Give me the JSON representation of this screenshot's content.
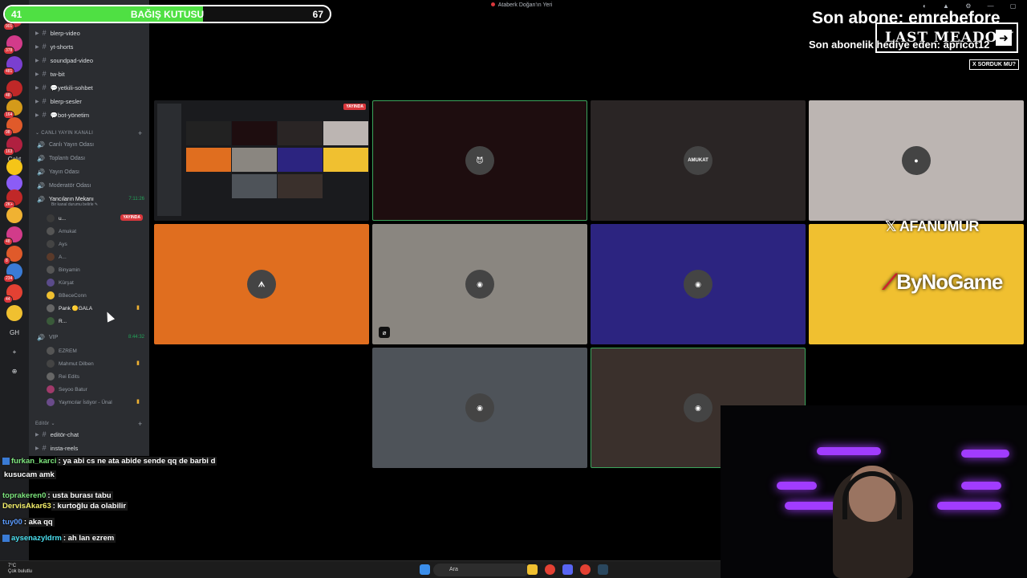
{
  "donation": {
    "title": "BAĞIŞ KUTUSU",
    "current": "41",
    "target": "67",
    "progress": 0.61
  },
  "window": {
    "title": "Ataberk Doğan'ın Yeri",
    "controls": "◐ ▲ ⚙ — ▢ ✕"
  },
  "overlay": {
    "last_sub": "Son abone: emrebefore",
    "last_gift": "Son abonelik hediye eden: apricot12",
    "last_meadow": "LAST MEADOW",
    "sorduk": "X SORDUK MU?",
    "afanumur": "AFANUMUR",
    "bynogame": "ByNoGame"
  },
  "rail": {
    "items": [
      {
        "badge": "901"
      },
      {
        "badge": "378"
      },
      {
        "badge": "481"
      },
      {
        "badge": "48"
      },
      {
        "badge": "164"
      },
      {
        "badge": "98"
      },
      {
        "badge": "163"
      },
      {
        "label": "Çalıt"
      },
      {
        "badge": ""
      },
      {
        "badge": ""
      },
      {
        "badge": "2K+"
      },
      {
        "badge": ""
      },
      {
        "badge": "48"
      },
      {
        "badge": "8"
      },
      {
        "badge": "234"
      },
      {
        "badge": "44"
      },
      {
        "badge": ""
      },
      {
        "label": "GH"
      },
      {
        "label": "+"
      },
      {
        "label": "⊕"
      }
    ]
  },
  "channels": {
    "text_top": [
      {
        "name": "blerp-video"
      },
      {
        "name": "yt-shorts"
      },
      {
        "name": "soundpad-video"
      },
      {
        "name": "tw-bit"
      },
      {
        "name": "💬yetkili-sohbet"
      },
      {
        "name": "blerp-sesler"
      },
      {
        "name": "💬bot-yönetim"
      }
    ],
    "voice_category": "CANLI YAYIN KANALI",
    "voice": [
      {
        "name": "Canlı Yayın Odası"
      },
      {
        "name": "Toplantı Odası"
      },
      {
        "name": "Yayın Odası"
      },
      {
        "name": "Moderatör Odası"
      }
    ],
    "active_voice": {
      "name": "Yancıların Mekanı",
      "time": "7:11:26",
      "sub": "Bir kanal durumu belirle ✎"
    },
    "users": [
      {
        "name": "u...",
        "live": "YAYINDA"
      },
      {
        "name": "Amukat"
      },
      {
        "name": "Ays"
      },
      {
        "name": "A..."
      },
      {
        "name": "Binyamin"
      },
      {
        "name": "Kürşat"
      },
      {
        "name": "BBeceConn"
      },
      {
        "name": "Pank 🟡GALA"
      },
      {
        "name": "R..."
      }
    ],
    "vip": {
      "name": "VIP",
      "time": "8:44:32"
    },
    "vip_users": [
      {
        "name": "EZREM"
      },
      {
        "name": "Mahmut Dilben"
      },
      {
        "name": "Rei Edits"
      },
      {
        "name": "Seyoo Batur"
      },
      {
        "name": "Yaymcılar İstiyor - Ünal"
      }
    ],
    "editor_category": "Editör",
    "editor_channels": [
      {
        "name": "editör-chat"
      },
      {
        "name": "insta-reels"
      }
    ]
  },
  "grid": {
    "screen_live": "YAYINDA",
    "tiles": [
      {
        "id": "t2",
        "bg": "#1e0d0f",
        "initials": "😈"
      },
      {
        "id": "t3",
        "bg": "#2a2525",
        "initials": "AMUKAT"
      },
      {
        "id": "t4",
        "bg": "#bcb5b2",
        "initials": "●"
      },
      {
        "id": "t5",
        "bg": "#e06e1f",
        "initials": "ᗑ"
      },
      {
        "id": "t6",
        "bg": "#8a8680",
        "initials": "◉"
      },
      {
        "id": "t7",
        "bg": "#2c2480",
        "initials": "◉"
      },
      {
        "id": "t8",
        "bg": "#f0c030",
        "initials": ""
      },
      {
        "id": "t9",
        "bg": "#4e5359",
        "initials": "◉"
      },
      {
        "id": "t10",
        "bg": "#3a302c",
        "initials": "◉"
      }
    ]
  },
  "chat": [
    {
      "user": "furkan_karci",
      "text": ": ya abi cs ne ata abide sende qq de barbi d",
      "cont": "kusucam amk"
    },
    {
      "user": "toprakeren0",
      "text": ": usta burası tabu"
    },
    {
      "user": "DervisAkar63",
      "text": ": kurtoğlu da olabilir"
    },
    {
      "user": "tuy00",
      "text": ": aka qq"
    },
    {
      "user": "aysenazyldrm",
      "text": ": ah lan ezrem"
    }
  ],
  "taskbar": {
    "weather": "7°C",
    "weather_desc": "Çok bulutlu",
    "search": "Ara"
  },
  "colors": {
    "accent_green": "#4fe043",
    "discord_bg": "#2b2d31",
    "live_red": "#da373c",
    "speaking": "#3ba55c"
  }
}
